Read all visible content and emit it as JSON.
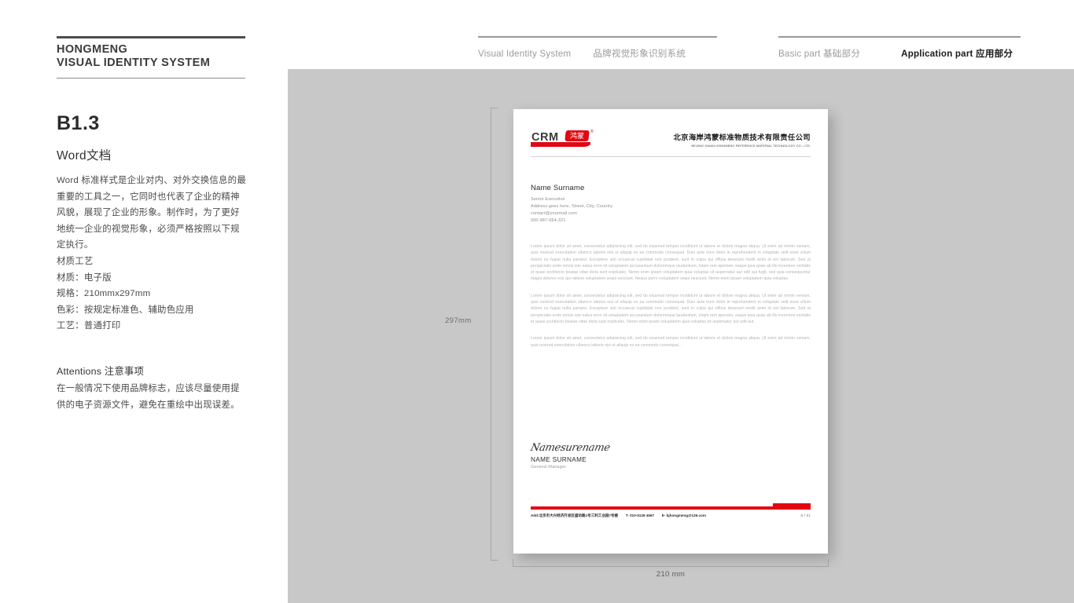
{
  "brand": {
    "line1": "HONGMENG",
    "line2": "VISUAL IDENTITY SYSTEM"
  },
  "header_nav": {
    "group1": {
      "en": "Visual Identity System",
      "cn": "品牌视觉形象识别系统"
    },
    "group2": {
      "basic": "Basic part  基础部分",
      "application": "Application part  应用部分"
    }
  },
  "section": {
    "code": "B1.3",
    "title": "Word文档",
    "intro": "Word 标准样式是企业对内、对外交换信息的最重要的工具之一，它同时也代表了企业的精神风貌，展现了企业的形象。制作时，为了更好地统一企业的视觉形象，必须严格按照以下规定执行。",
    "spec_heading": "材质工艺",
    "specs": [
      "材质：电子版",
      "规格：210mmx297mm",
      "色彩：按规定标准色、辅助色应用",
      "工艺：普通打印"
    ],
    "attentions_heading": "Attentions 注意事项",
    "attentions_body": "在一般情况下使用品牌标志，应该尽量使用提供的电子资源文件，避免在重绘中出现误差。"
  },
  "dimensions": {
    "height_label": "297mm",
    "width_label": "210 mm"
  },
  "letterhead": {
    "logo": {
      "wordmark": "CRM",
      "badge_text": "鸿蒙",
      "registered": "®"
    },
    "company": {
      "cn": "北京海岸鸿蒙标准物质技术有限责任公司",
      "en": "BEIJING HAIAN HONGMENG REFERENCE MATERIAL TECHNOLOGY CO., LTD."
    },
    "recipient": {
      "name": "Name Surname",
      "title": "Senior Executive",
      "address": "Address goes here, Street, City, Country",
      "email": "contact@yourmail.com",
      "phone": "000-987-654-321"
    },
    "paragraphs": [
      "Lorem ipsum dolor sit amet, consectetur adipisicing elit, sed do eiusmod tempor incididunt ut labore et dolore magna aliqua. Ut enim ad minim veniam, quis nostrud exercitation ullamco laboris nisi ut aliquip ex ea commodo consequat. Duis aute irure dolor in reprehenderit in voluptate velit esse cillum dolore eu fugiat nulla pariatur. Excepteur sint occaecat cupidatat non proident, sunt in culpa qui officia deserunt mollit anim id est laborum. Sed ut perspiciatis unde omnis iste natus error sit voluptatem accusantium doloremque laudantium, totam rem aperiam, eaque ipsa quae ab illo inventore veritatis et quasi architecto beatae vitae dicta sunt explicabo. Nemo enim ipsam voluptatem quia voluptas sit aspernatur aut odit aut fugit, sed quia consequuntur magni dolores eos qui ratione voluptatem sequi nesciunt. Neque porro voluptatem sequi nesciunt. Nemo enim ipsam voluptatem quia voluptas.",
      "Lorem ipsum dolor sit amet, consectetur adipisicing elit, sed do eiusmod tempor incididunt ut labore et dolore magna aliqua. Ut enim ad minim veniam, quis nostrud exercitation ullamco laboris nisi ut aliquip ex ea commodo consequat. Duis aute irure dolor in reprehenderit in voluptate velit esse cillum dolore eu fugiat nulla pariatur. Excepteur sint occaecat cupidatat non proident, sunt in culpa qui officia deserunt mollit anim id est laborum. Sed ut perspiciatis unde omnis iste natus error sit voluptatem accusantium doloremque laudantium, totam rem aperiam, eaque ipsa quae ab illo inventore veritatis et quasi architecto beatae vitae dicta sunt explicabo. Nemo enim ipsam voluptatem quia voluptas sit aspernatur aut odit aut.",
      "Lorem ipsum dolor sit amet, consectetur adipisicing elit, sed do eiusmod tempor incididunt ut labore et dolore magna aliqua. Ut enim ad minim veniam, quis nostrud exercitation ullamco laboris nisi ut aliquip ex ea commodo consequat. ."
    ],
    "signature": {
      "script": "Namesurename",
      "name": "NAME SURNAME",
      "role": "General Manager"
    },
    "footer": {
      "address": "Add:北京市大兴经济开发区盛坊路1号三利工业园7号楼",
      "tel": "T- 010-5128 4567",
      "email": "E- bjhongmeng@126.com",
      "page": "6 / 01"
    }
  },
  "colors": {
    "brand_red": "#e30613",
    "footer_blue": "#2f5fbf",
    "canvas_gray": "#c8c8c8"
  }
}
